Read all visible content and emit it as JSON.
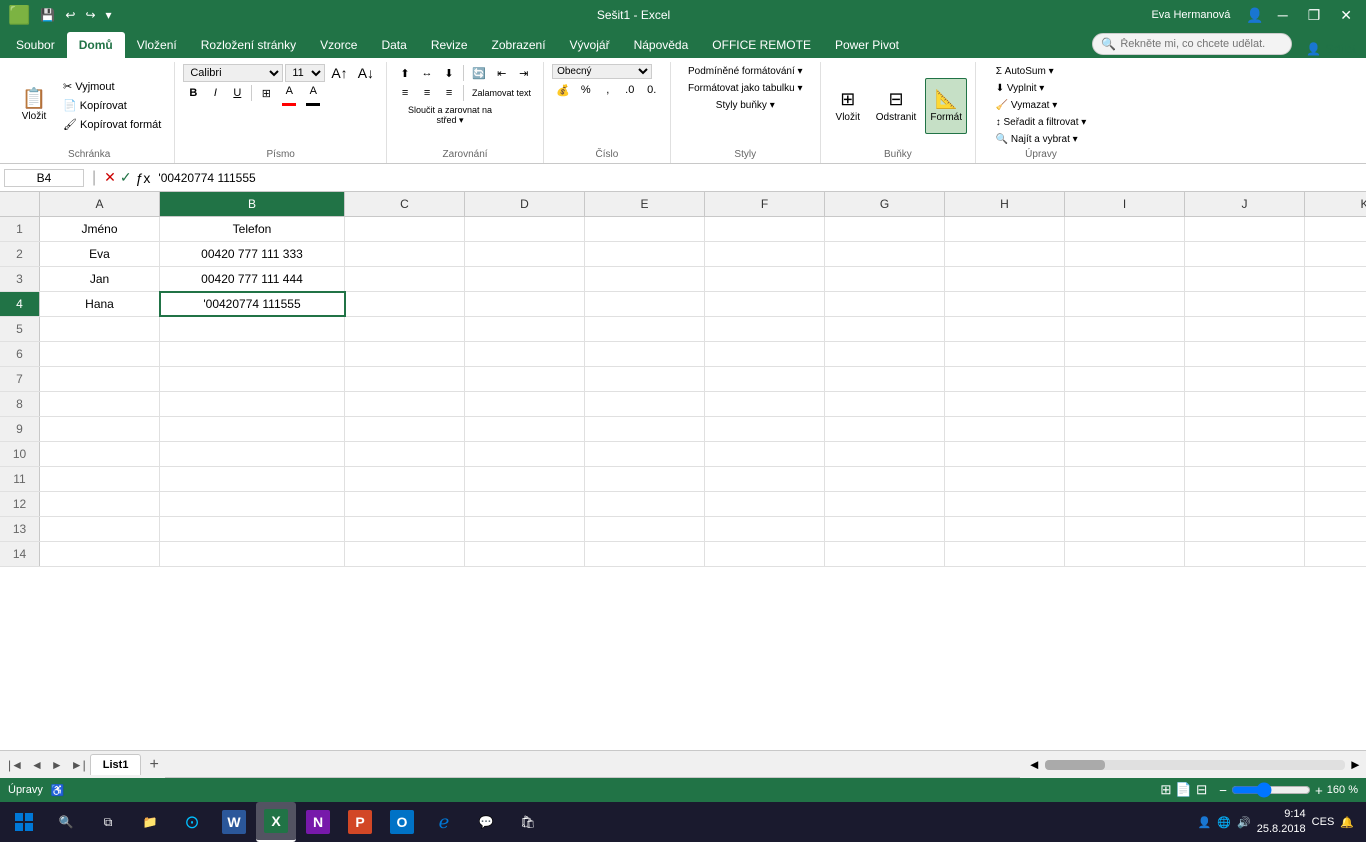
{
  "titleBar": {
    "title": "Sešit1 - Excel",
    "user": "Eva Hermanová",
    "minimize": "─",
    "restore": "❐",
    "close": "✕"
  },
  "ribbon": {
    "tabs": [
      "Soubor",
      "Domů",
      "Vložení",
      "Rozložení stránky",
      "Vzorce",
      "Data",
      "Revize",
      "Zobrazení",
      "Vývojář",
      "Nápověda",
      "OFFICE REMOTE",
      "Power Pivot"
    ],
    "activeTab": "Domů",
    "searchPlaceholder": "Řekněte mi, co chcete udělat.",
    "shareLabel": "Sdílet",
    "groups": {
      "schrankaLabel": "Schránka",
      "pismoLabel": "Písmo",
      "zarovnaniLabel": "Zarovnání",
      "cisloLabel": "Číslo",
      "stylyLabel": "Styly",
      "bunkyLabel": "Buňky",
      "upravyLabel": "Úpravy"
    },
    "font": {
      "name": "Calibri",
      "size": "11"
    },
    "buttons": {
      "autoSum": "AutoSum ▾",
      "vyplnit": "Vyplnit ▾",
      "vymazat": "Vymazat ▾",
      "seradit": "Seřadit a filtrovat ▾",
      "najit": "Najít a vybrat ▾",
      "podmFormLabel": "Podmíněné formátování ▾",
      "formatTabulka": "Formátovat jako tabulku ▾",
      "stylyBunky": "Styly buňky ▾",
      "vlozit": "Vložit",
      "odstranit": "Odstranit",
      "format": "Formát"
    }
  },
  "formulaBar": {
    "cellRef": "B4",
    "formula": "'00420774 111555"
  },
  "columns": [
    "A",
    "B",
    "C",
    "D",
    "E",
    "F",
    "G",
    "H",
    "I",
    "J",
    "K"
  ],
  "rows": [
    {
      "num": 1,
      "cells": [
        "Jméno",
        "Telefon",
        "",
        "",
        "",
        "",
        "",
        "",
        "",
        "",
        ""
      ]
    },
    {
      "num": 2,
      "cells": [
        "Eva",
        "00420 777 111 333",
        "",
        "",
        "",
        "",
        "",
        "",
        "",
        "",
        ""
      ]
    },
    {
      "num": 3,
      "cells": [
        "Jan",
        "00420 777 111 444",
        "",
        "",
        "",
        "",
        "",
        "",
        "",
        "",
        ""
      ]
    },
    {
      "num": 4,
      "cells": [
        "Hana",
        "'00420774 111555",
        "",
        "",
        "",
        "",
        "",
        "",
        "",
        "",
        ""
      ]
    },
    {
      "num": 5,
      "cells": [
        "",
        "",
        "",
        "",
        "",
        "",
        "",
        "",
        "",
        "",
        ""
      ]
    },
    {
      "num": 6,
      "cells": [
        "",
        "",
        "",
        "",
        "",
        "",
        "",
        "",
        "",
        "",
        ""
      ]
    },
    {
      "num": 7,
      "cells": [
        "",
        "",
        "",
        "",
        "",
        "",
        "",
        "",
        "",
        "",
        ""
      ]
    },
    {
      "num": 8,
      "cells": [
        "",
        "",
        "",
        "",
        "",
        "",
        "",
        "",
        "",
        "",
        ""
      ]
    },
    {
      "num": 9,
      "cells": [
        "",
        "",
        "",
        "",
        "",
        "",
        "",
        "",
        "",
        "",
        ""
      ]
    },
    {
      "num": 10,
      "cells": [
        "",
        "",
        "",
        "",
        "",
        "",
        "",
        "",
        "",
        "",
        ""
      ]
    },
    {
      "num": 11,
      "cells": [
        "",
        "",
        "",
        "",
        "",
        "",
        "",
        "",
        "",
        "",
        ""
      ]
    },
    {
      "num": 12,
      "cells": [
        "",
        "",
        "",
        "",
        "",
        "",
        "",
        "",
        "",
        "",
        ""
      ]
    },
    {
      "num": 13,
      "cells": [
        "",
        "",
        "",
        "",
        "",
        "",
        "",
        "",
        "",
        "",
        ""
      ]
    },
    {
      "num": 14,
      "cells": [
        "",
        "",
        "",
        "",
        "",
        "",
        "",
        "",
        "",
        "",
        ""
      ]
    }
  ],
  "activeCell": {
    "row": 4,
    "col": "B"
  },
  "sheets": [
    "List1"
  ],
  "activeSheet": "List1",
  "status": {
    "mode": "Úpravy",
    "zoom": "160 %"
  },
  "taskbar": {
    "time": "9:14",
    "date": "25.8.2018",
    "language": "CES"
  }
}
